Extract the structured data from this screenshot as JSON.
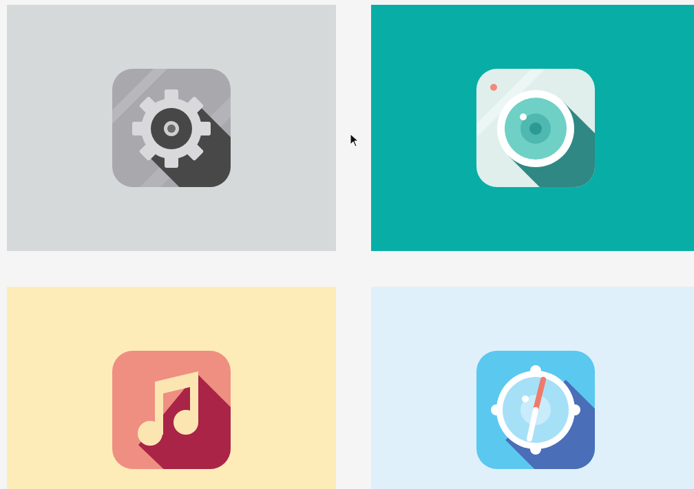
{
  "tiles": [
    {
      "kind": "gear",
      "color": "#d5d9da"
    },
    {
      "kind": "camera",
      "color": "#08aea6"
    },
    {
      "kind": "music",
      "color": "#feecb8"
    },
    {
      "kind": "compass",
      "color": "#e0f0fa"
    }
  ]
}
